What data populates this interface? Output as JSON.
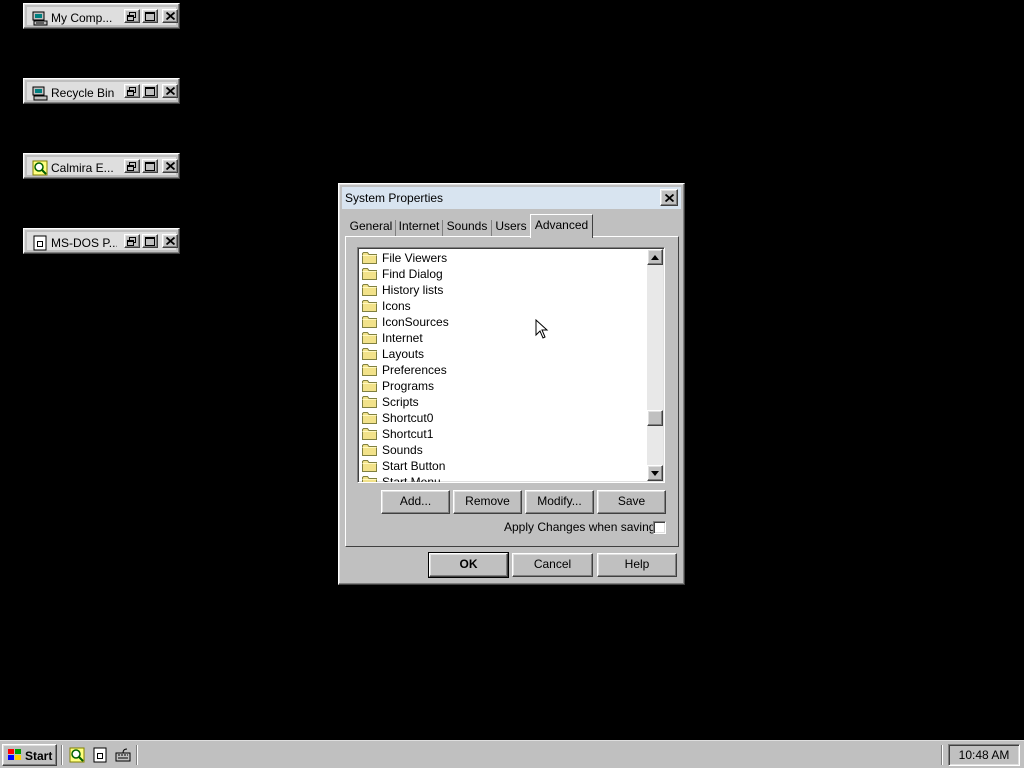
{
  "desktop": {
    "minimized_windows": [
      {
        "title": "My Comp...",
        "icon": "computer-icon"
      },
      {
        "title": "Recycle Bin",
        "icon": "recycle-bin-icon"
      },
      {
        "title": "Calmira E...",
        "icon": "explorer-magnifier-icon"
      },
      {
        "title": "MS-DOS P...",
        "icon": "msdos-prompt-icon"
      }
    ]
  },
  "dialog": {
    "title": "System Properties",
    "tabs": [
      {
        "label": "General"
      },
      {
        "label": "Internet"
      },
      {
        "label": "Sounds"
      },
      {
        "label": "Users"
      },
      {
        "label": "Advanced",
        "selected": true
      }
    ],
    "list_items": [
      "File Viewers",
      "Find Dialog",
      "History lists",
      "Icons",
      "IconSources",
      "Internet",
      "Layouts",
      "Preferences",
      "Programs",
      "Scripts",
      "Shortcut0",
      "Shortcut1",
      "Sounds",
      "Start Button",
      "Start Menu"
    ],
    "buttons": {
      "add": "Add...",
      "remove": "Remove",
      "modify": "Modify...",
      "save": "Save"
    },
    "apply_changes_label": "Apply Changes when saving:",
    "apply_changes_checked": false,
    "footer": {
      "ok": "OK",
      "cancel": "Cancel",
      "help": "Help"
    }
  },
  "taskbar": {
    "start_label": "Start",
    "quick_launch": [
      "explorer-magnifier-icon",
      "msdos-prompt-icon",
      "keyboard-icon"
    ],
    "clock": "10:48 AM"
  },
  "colors": {
    "desktop": "#000000",
    "face": "#c0c0c0",
    "titlebar": "#d8e4f0",
    "folder_yellow": "#f2e28a"
  }
}
